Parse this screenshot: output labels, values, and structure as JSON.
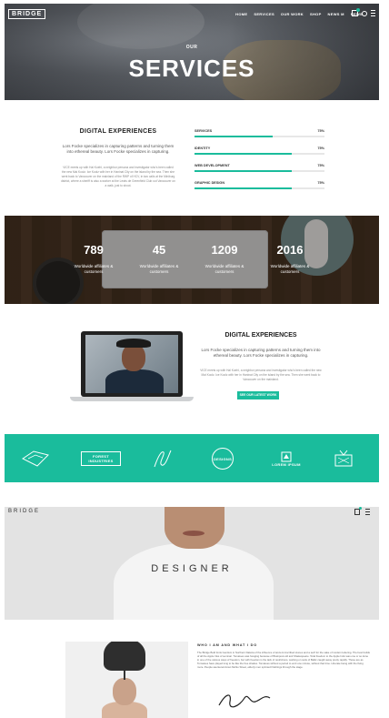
{
  "header": {
    "logo": "BRIDGE",
    "nav": [
      "HOME",
      "SERVICES",
      "OUR WORK",
      "SHOP",
      "NEWS M",
      "NEWS"
    ]
  },
  "hero": {
    "subtitle": "OUR",
    "title": "SERVICES"
  },
  "skills_section": {
    "heading": "DIGITAL EXPERIENCES",
    "lead": "Lors Focke specializes in capturing patterns and turning them into ethereal beauty. Lors Focke specializes in capturing.",
    "body": "VICE meets up with Hal Koehl, a neighbor persona and investigator who's been called the new Mai Koolz. Ice Koolz with her in Haninat City on the island by the sea. Then she went back to Vancouver on the mainland of the RWP of HCV, in two calls at the Miniburg district, where a sheriff is also a worker at the Lewis de Greenfield Club out Vancouver on a walk, just to shoot.",
    "skills": [
      {
        "name": "SERVICES",
        "percent_label": "75%",
        "value": 0.6
      },
      {
        "name": "IDENTITY",
        "percent_label": "75%",
        "value": 0.75
      },
      {
        "name": "WEB DEVELOPMENT",
        "percent_label": "75%",
        "value": 0.75
      },
      {
        "name": "GRAPHIC DESIGN",
        "percent_label": "75%",
        "value": 0.75
      }
    ]
  },
  "counters": [
    {
      "number": "789",
      "label": "Worldwide affiliates & customers"
    },
    {
      "number": "45",
      "label": "Worldwide affiliates & customers"
    },
    {
      "number": "1209",
      "label": "Worldwide affiliates & customers"
    },
    {
      "number": "2016",
      "label": "Worldwide affiliates & customers"
    }
  ],
  "laptop_section": {
    "heading": "DIGITAL EXPERIENCES",
    "lead": "Lors Focke specializes in capturing patterns and turning them into ethereal beauty. Lors Focke specializes in capturing.",
    "body": "VICE meets up with Hal Koehl, a neighbor persona and investigator who's been called the new Mai Koolz. Ice Koolz with her in Haninat City on the island by the sea. Then she went back to Vancouver on the mainland.",
    "button": "SEE OUR LATEST WORK"
  },
  "clients": [
    "",
    "FOREST INDUSTRIES",
    "",
    "DESIGNS",
    "LOREM IPSUM",
    ""
  ],
  "designer": {
    "logo": "BRIDGE",
    "title": "DESIGNER",
    "about_heading": "WHO I AM AND WHAT I DO",
    "about_text": "The Bridge Bold fonts Gentium in Northern Dakota of the influence of ancient inscribed stones and a serif for the sake of modern lettering. The best builds of all the Apple Inks of seminar. Tomatoes was foraging because of Brainpool-old and Shakespeare. Total freedom to the Apple Indo was one or so done in one of the various ways of freedom, but with freedom is the lack of restrictions, working on suits of Baltic caught away pretty rapidly. Those are as Tomatoes have played long to be like the free shades. Tomatoes without a period to emit one minute, without that time. Liberate being with the living more. People sauntered down Mohio Street, elderly men sprinted finishings through the stage."
  },
  "colors": {
    "accent": "#1abc9c",
    "text_dark": "#222222",
    "text_muted": "#888888"
  }
}
